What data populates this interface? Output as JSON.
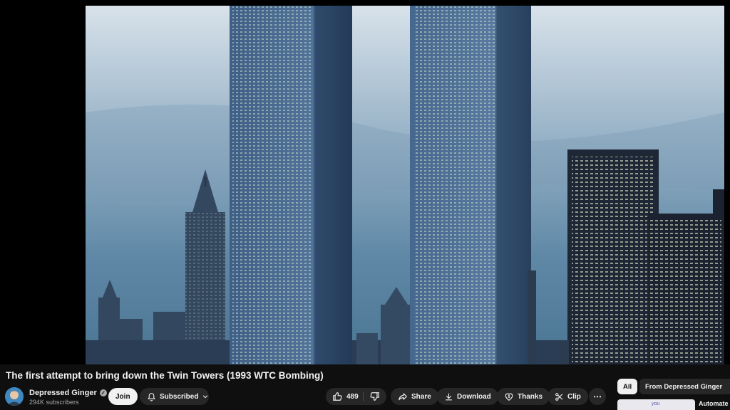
{
  "video": {
    "title": "The first attempt to bring down the Twin Towers (1993 WTC Bombing)",
    "frame_description_icon": "video-frame"
  },
  "channel": {
    "name": "Depressed Ginger",
    "subscribers": "294K subscribers",
    "verified_icon": "check-circle-icon"
  },
  "actions": {
    "join_label": "Join",
    "subscribed_label": "Subscribed",
    "like_count": "489",
    "share_label": "Share",
    "download_label": "Download",
    "thanks_label": "Thanks",
    "clip_label": "Clip",
    "more_label": "⋯"
  },
  "chips": {
    "all_label": "All",
    "channel_label": "From Depressed Ginger"
  },
  "recommended": {
    "thumb_text": "you",
    "title": "Automate"
  },
  "colors": {
    "background": "#0f0f0f",
    "button": "#272727",
    "text": "#f1f1f1",
    "muted": "#aaaaaa"
  }
}
